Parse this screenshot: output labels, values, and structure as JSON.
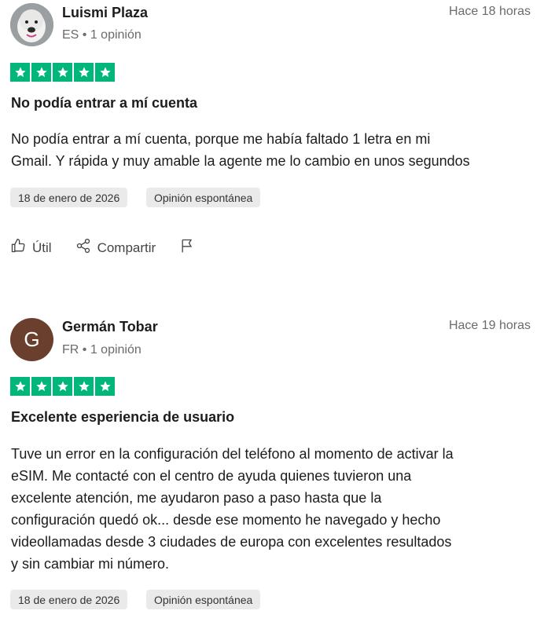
{
  "reviews": [
    {
      "name": "Luismi Plaza",
      "meta": "ES • 1 opinión",
      "time": "Hace 18 horas",
      "rating": 5,
      "title": "No podía entrar a mí cuenta",
      "body": "No podía entrar a mí cuenta, porque me había faltado 1 letra en mi\nGmail. Y rápida y muy amable la agente me lo cambio en unos segundos",
      "date": "18 de enero de 2026",
      "tag": "Opinión espontánea",
      "avatar_type": "photo"
    },
    {
      "name": "Germán Tobar",
      "meta": "FR • 1 opinión",
      "time": "Hace 19 horas",
      "rating": 5,
      "avatar_letter": "G",
      "title": "Excelente esperiencia de usuario",
      "body": "Tuve un error en la configuración del teléfono al momento de activar la\neSIM. Me contacté con el centro de ayuda quienes tuvieron una\nexcelente atención, me ayudaron paso a paso hasta que la\nconfiguración quedó ok... desde ese momento he navegado y hecho\nvideollamadas desde 3 ciudades de europa con excelentes resultados\ny sin cambiar mi número.",
      "date": "18 de enero de 2026",
      "tag": "Opinión espontánea",
      "avatar_type": "letter"
    }
  ],
  "actions": {
    "useful": "Útil",
    "share": "Compartir"
  },
  "colors": {
    "star_green": "#00b67a",
    "avatar_brown": "#6b3f2e"
  },
  "icons": [
    "thumbs-up-icon",
    "share-icon",
    "flag-icon",
    "star-icon"
  ]
}
